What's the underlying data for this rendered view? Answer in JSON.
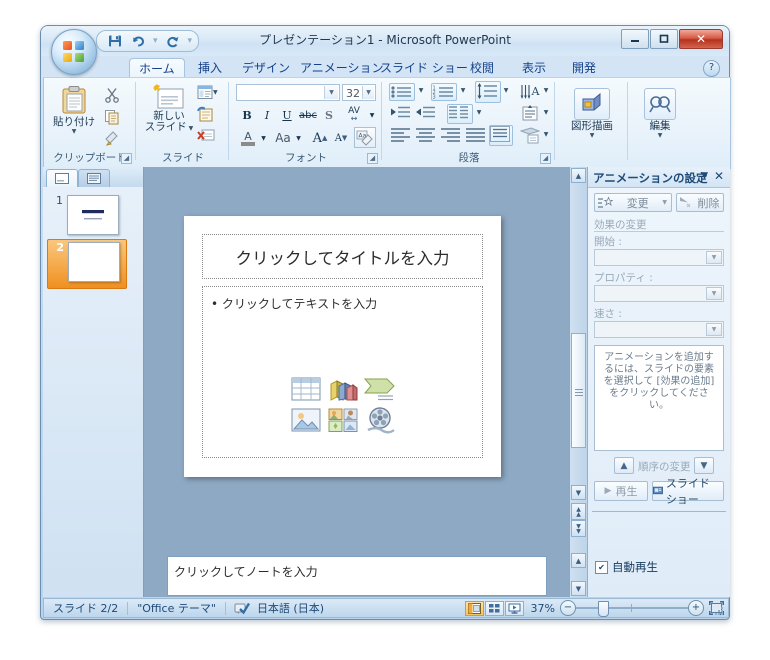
{
  "window": {
    "title": "プレゼンテーション1 - Microsoft PowerPoint",
    "minimize": "—",
    "maximize": "▫",
    "close": "✕"
  },
  "quick_access": {
    "save": "save-icon",
    "undo": "undo-icon",
    "redo": "redo-icon",
    "customize": "▾"
  },
  "tabs": [
    {
      "label": "ホーム",
      "active": true
    },
    {
      "label": "挿入",
      "active": false
    },
    {
      "label": "デザイン",
      "active": false
    },
    {
      "label": "アニメーション",
      "active": false
    },
    {
      "label": "スライド ショー",
      "active": false
    },
    {
      "label": "校閲",
      "active": false
    },
    {
      "label": "表示",
      "active": false
    },
    {
      "label": "開発",
      "active": false
    }
  ],
  "help_button": "?",
  "ribbon": {
    "groups": [
      {
        "name": "クリップボード"
      },
      {
        "name": "スライド"
      },
      {
        "name": "フォント"
      },
      {
        "name": "段落"
      }
    ],
    "clipboard": {
      "paste": "貼り付け",
      "cut_tip": "切り取り",
      "copy_tip": "コピー",
      "format_painter_tip": "書式のコピー／貼り付け"
    },
    "slides": {
      "new_slide": "新しい\nスライド",
      "new_slide_line1": "新しい",
      "new_slide_line2": "スライド",
      "layout_tip": "レイアウト",
      "reset_tip": "リセット",
      "delete_tip": "削除"
    },
    "font": {
      "font_name": "",
      "font_size": "32",
      "bold": "B",
      "italic": "I",
      "underline": "U",
      "strikethrough": "abc",
      "shadow": "S",
      "spacing": "AV",
      "color": "A",
      "case": "Aa",
      "grow": "A",
      "shrink": "A",
      "clear": "Aa"
    },
    "paragraph": {
      "bullets_tip": "箇条書き",
      "numbering_tip": "段落番号",
      "line_spacing_tip": "行間",
      "text_direction_tip": "文字列の方向",
      "align_text_tip": "文字の配置",
      "smartart_tip": "SmartArt グラフィックに変換",
      "dec_indent_tip": "インデントを減らす",
      "inc_indent_tip": "インデントを増やす",
      "columns_tip": "段組み",
      "align_left_tip": "左揃え",
      "align_center_tip": "中央揃え",
      "align_right_tip": "右揃え",
      "justify_tip": "両端揃え",
      "distribute_tip": "均等割り付け"
    },
    "drawing": {
      "label": "図形描画"
    },
    "editing": {
      "label": "編集"
    }
  },
  "slide_pane": {
    "tab_slides": "slides-tab-icon",
    "tab_outline": "outline-tab-icon",
    "thumbnails": [
      {
        "number": "1",
        "selected": false
      },
      {
        "number": "2",
        "selected": true
      }
    ]
  },
  "slide": {
    "title_placeholder": "クリックしてタイトルを入力",
    "body_placeholder": "クリックしてテキストを入力",
    "content_icons": [
      "table-icon",
      "chart-icon",
      "smartart-icon",
      "picture-icon",
      "clipart-icon",
      "media-icon"
    ]
  },
  "notes": {
    "placeholder": "クリックしてノートを入力"
  },
  "animation_pane": {
    "title": "アニメーションの設定",
    "dropdown_icon": "▼",
    "close_icon": "✕",
    "change_button": "変更",
    "remove_button": "削除",
    "section_label": "効果の変更",
    "start_label": "開始 :",
    "start_value": "",
    "property_label": "プロパティ :",
    "property_value": "",
    "speed_label": "速さ :",
    "speed_value": "",
    "empty_message": "アニメーションを追加するには、スライドの要素を選択して [効果の追加] をクリックしてください。",
    "reorder_label": "順序の変更",
    "reorder_up": "▲",
    "reorder_down": "▼",
    "play_button": "再生",
    "slideshow_button": "スライド ショー",
    "autoplay_checkbox": "自動再生",
    "autoplay_checked": true
  },
  "status_bar": {
    "slide_count": "スライド 2/2",
    "theme": "\"Office テーマ\"",
    "spellcheck_icon": "spellcheck-icon",
    "language": "日本語 (日本)",
    "view_normal": "normal-view-icon",
    "view_sorter": "slide-sorter-icon",
    "view_slideshow": "slideshow-view-icon",
    "zoom_level": "37%",
    "zoom_out": "−",
    "zoom_in": "+",
    "fit_window": "fit-slide-icon"
  }
}
